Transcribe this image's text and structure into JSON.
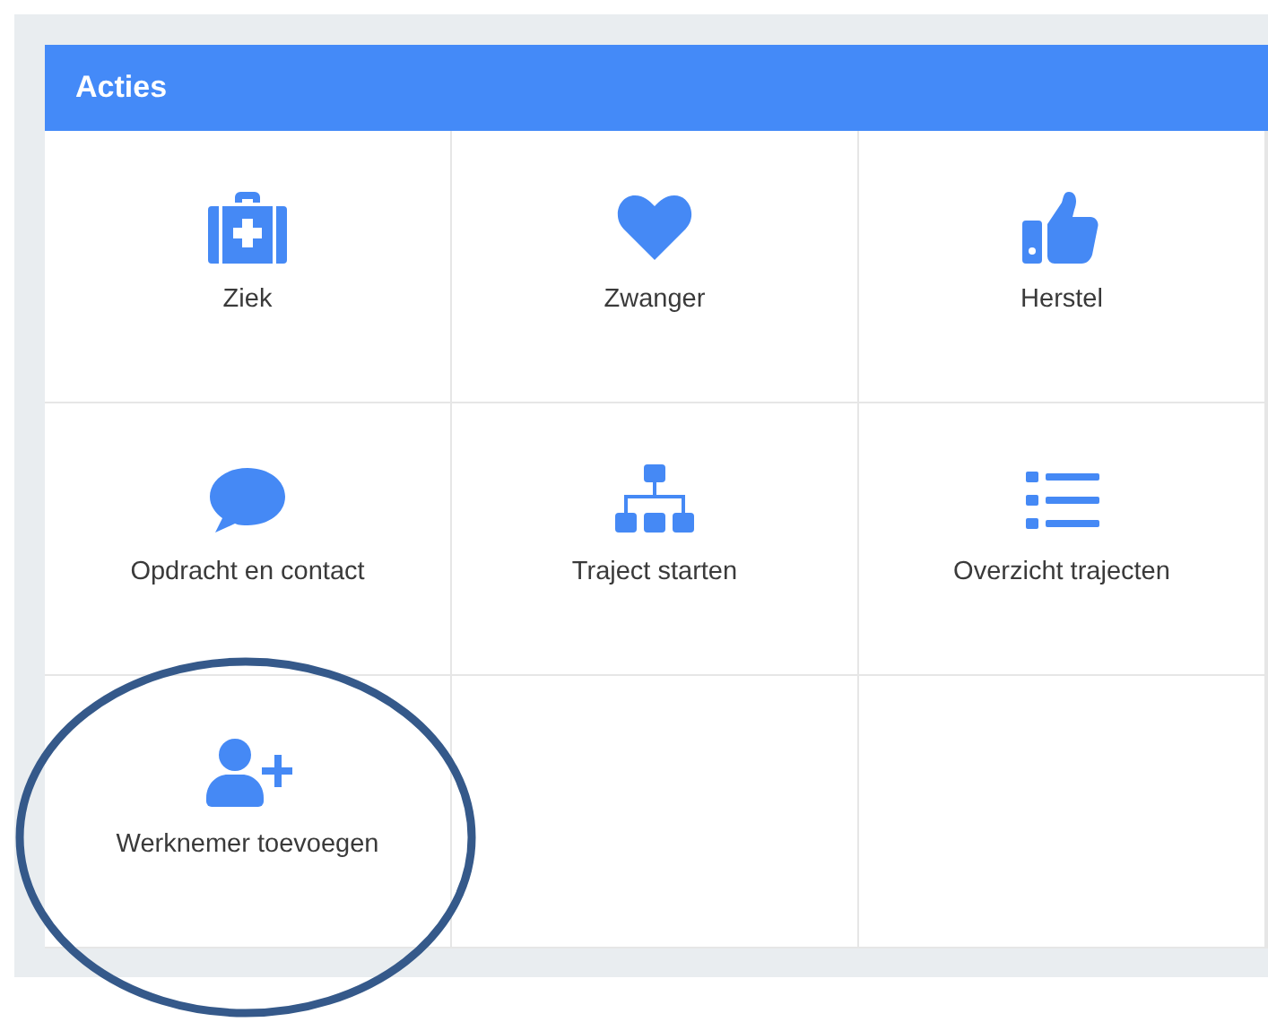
{
  "panel": {
    "title": "Acties"
  },
  "actions": [
    {
      "label": "Ziek",
      "kind": "medkit",
      "circled": false
    },
    {
      "label": "Zwanger",
      "kind": "heart",
      "circled": false
    },
    {
      "label": "Herstel",
      "kind": "thumb",
      "circled": false
    },
    {
      "label": "Opdracht en contact",
      "kind": "comment",
      "circled": false
    },
    {
      "label": "Traject starten",
      "kind": "tree",
      "circled": false
    },
    {
      "label": "Overzicht trajecten",
      "kind": "list",
      "circled": false
    },
    {
      "label": "Werknemer toevoegen",
      "kind": "adduser",
      "circled": true
    }
  ]
}
